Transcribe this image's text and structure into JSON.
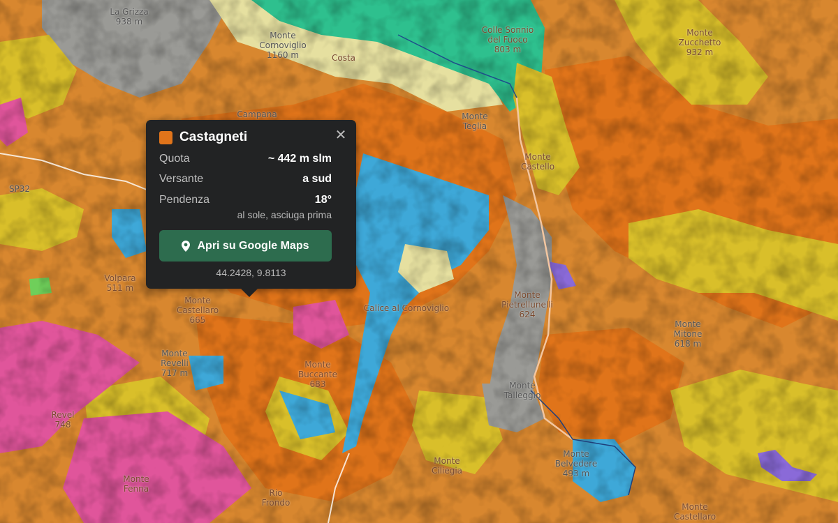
{
  "map": {
    "colors": {
      "castagneti": "#e0741a",
      "bosco": "#d8872f",
      "prati": "#d9bf2a",
      "acqua": "#3ea8d8",
      "verde": "#2ec08e",
      "rosa": "#e0559b",
      "rocce": "#9a9a96",
      "coltivi": "#e6e0a0",
      "viola": "#8a6ad8",
      "strade": "#ffffff"
    },
    "places": [
      {
        "label": "La Grizza\n938 m",
        "style": "gray"
      },
      {
        "label": "Monte\nCornoviglio\n1160 m",
        "style": "gray"
      },
      {
        "label": "Costa",
        "style": "brown"
      },
      {
        "label": "Colle Sonnio\ndel Fuoco\n803 m",
        "style": "brown"
      },
      {
        "label": "Monte\nZucchetto\n932 m",
        "style": "brown"
      },
      {
        "label": "Campana",
        "style": "gray"
      },
      {
        "label": "Monte\nTeglia",
        "style": "gray"
      },
      {
        "label": "Monte\nCastello",
        "style": "brown"
      },
      {
        "label": "Volpara\n511 m",
        "style": "brown"
      },
      {
        "label": "Monte\nCastellaro\n665",
        "style": "brown"
      },
      {
        "label": "Calice al Cornoviglio",
        "style": "brown"
      },
      {
        "label": "Monte\nPietrellunelli\n624",
        "style": "brown"
      },
      {
        "label": "Monte\nMitone\n618 m",
        "style": "gray"
      },
      {
        "label": "Monte\nRevelli\n717 m",
        "style": "gray"
      },
      {
        "label": "Monte\nBuccante\n683",
        "style": "brown"
      },
      {
        "label": "Monte\nCiliegia",
        "style": "brown"
      },
      {
        "label": "Monte\nBelvedere\n493 m",
        "style": "gray"
      },
      {
        "label": "Monte\nCastellaro",
        "style": "brown"
      },
      {
        "label": "Monte\nFenna",
        "style": "brown"
      },
      {
        "label": "Rio\nFrondo",
        "style": "brown"
      },
      {
        "label": "Revel\n748",
        "style": "brown"
      },
      {
        "label": "SP32",
        "style": "gray"
      },
      {
        "label": "Monte\nTalleggio",
        "style": "gray"
      }
    ]
  },
  "popup": {
    "title": "Castagneti",
    "swatch_color": "#e0741a",
    "close_icon": "close-icon",
    "rows": [
      {
        "label": "Quota",
        "value": "~ 442 m slm"
      },
      {
        "label": "Versante",
        "value": "a sud"
      },
      {
        "label": "Pendenza",
        "value": "18°"
      }
    ],
    "note": "al sole, asciuga prima",
    "button_label": "Apri su Google Maps",
    "button_icon": "map-pin-icon",
    "button_color": "#2d6c4e",
    "coords": "44.2428, 9.8113"
  }
}
